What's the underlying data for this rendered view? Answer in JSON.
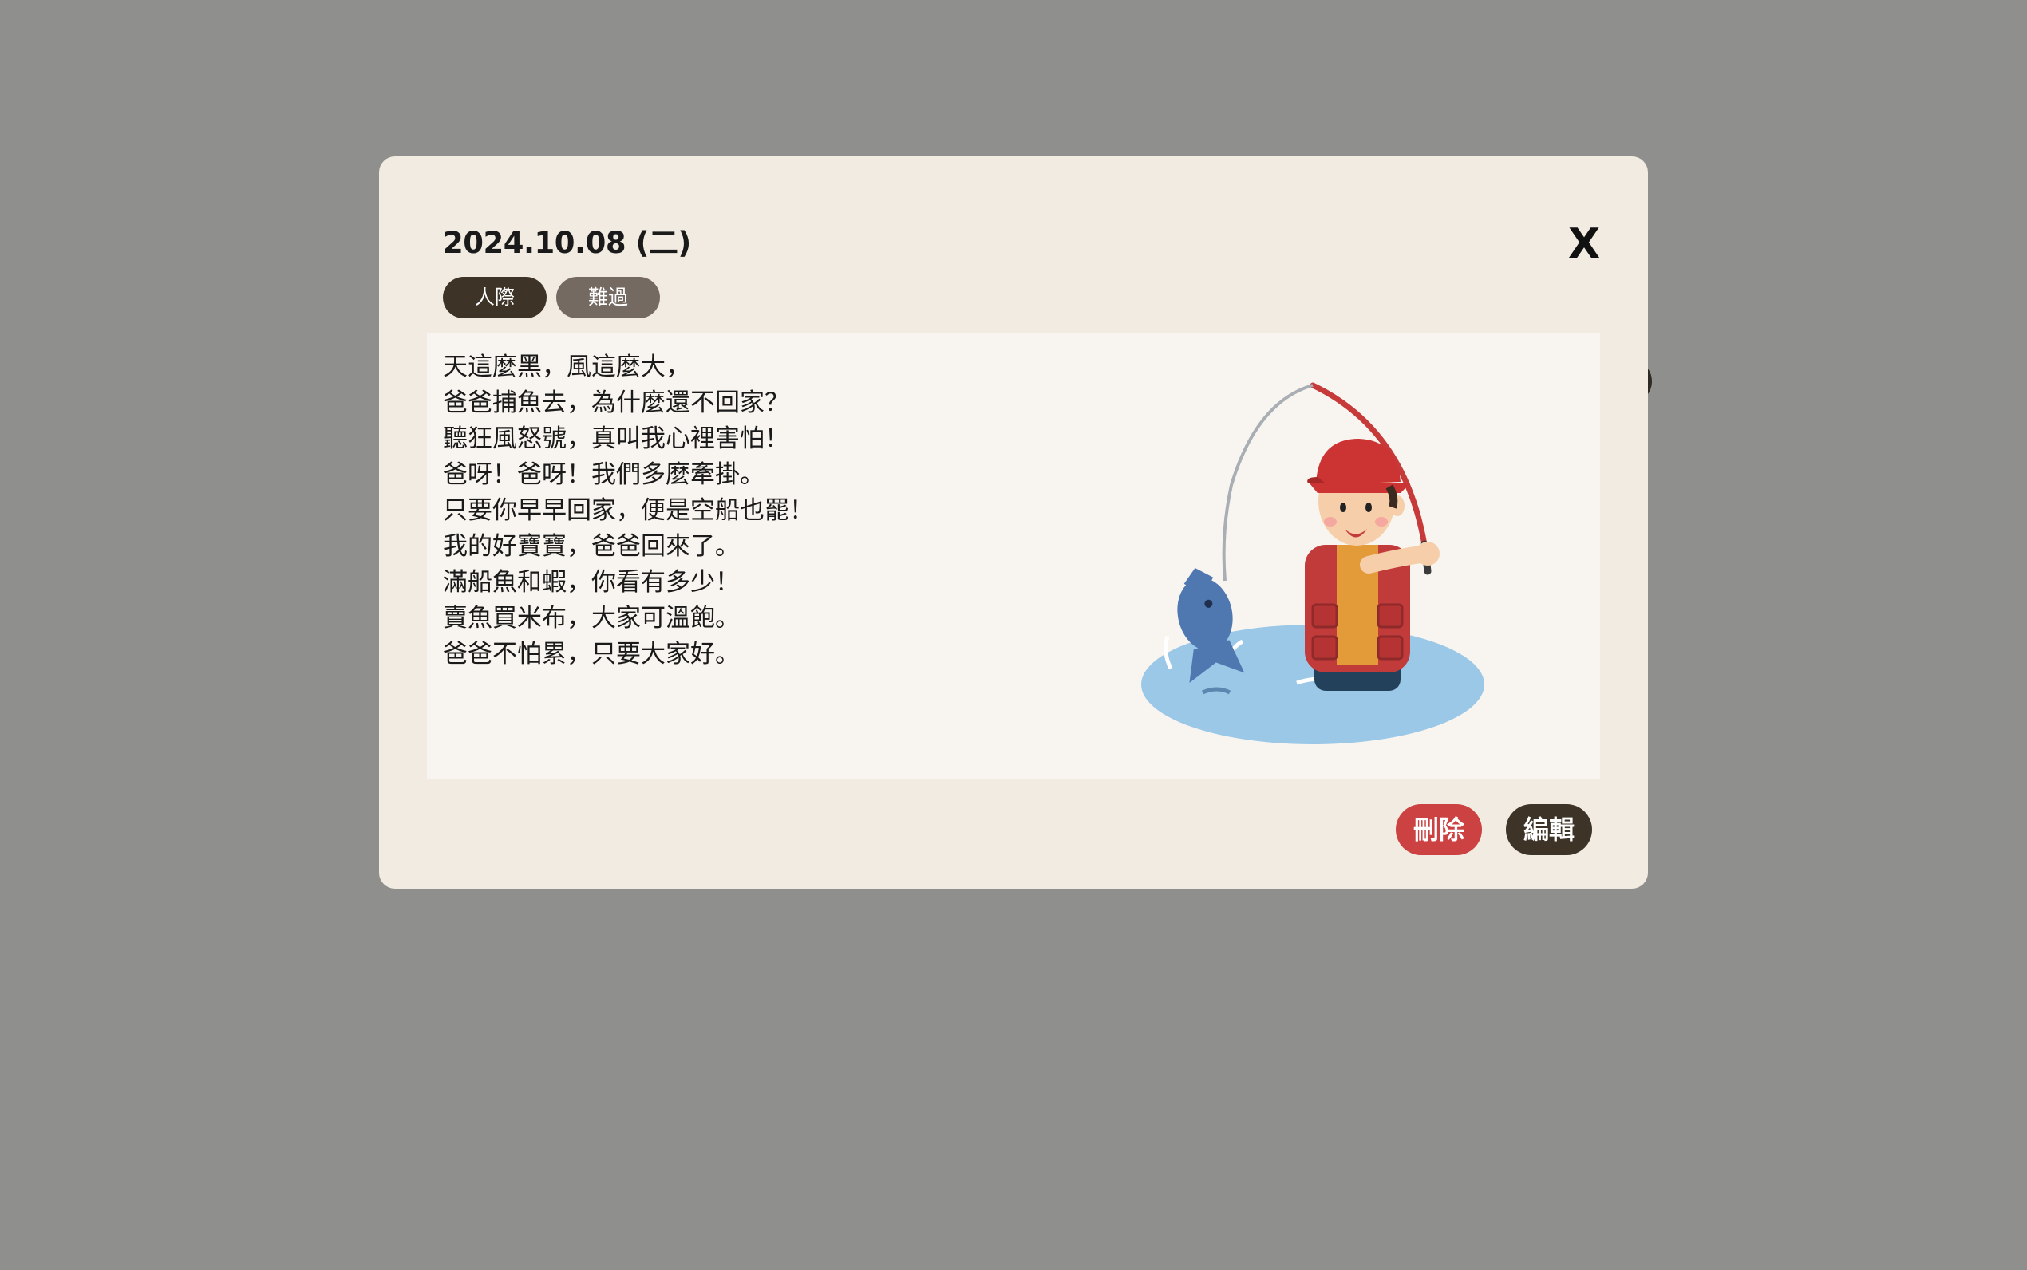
{
  "entry": {
    "date": "2024.10.08 (二)",
    "close_label": "X",
    "tags": [
      "人際",
      "難過"
    ],
    "poem_lines": [
      "天這麼黑，風這麼大，",
      "爸爸捕魚去，為什麼還不回家？",
      "聽狂風怒號，真叫我心裡害怕！",
      "爸呀！爸呀！我們多麼牽掛。",
      "只要你早早回家，便是空船也罷！",
      "我的好寶寶，爸爸回來了。",
      "滿船魚和蝦，你看有多少！",
      "賣魚買米布，大家可溫飽。",
      "爸爸不怕累，只要大家好。"
    ]
  },
  "actions": {
    "delete_label": "刪除",
    "edit_label": "編輯"
  },
  "colors": {
    "backdrop": "#8f8f8d",
    "modal_bg": "#f2ebe1",
    "content_bg": "#f8f5f0",
    "tag_primary": "#3d3327",
    "tag_secondary": "#746a62",
    "delete": "#cc4141",
    "edit": "#3d3327"
  },
  "illustration": {
    "icon": "fisherman-illustration-icon"
  }
}
